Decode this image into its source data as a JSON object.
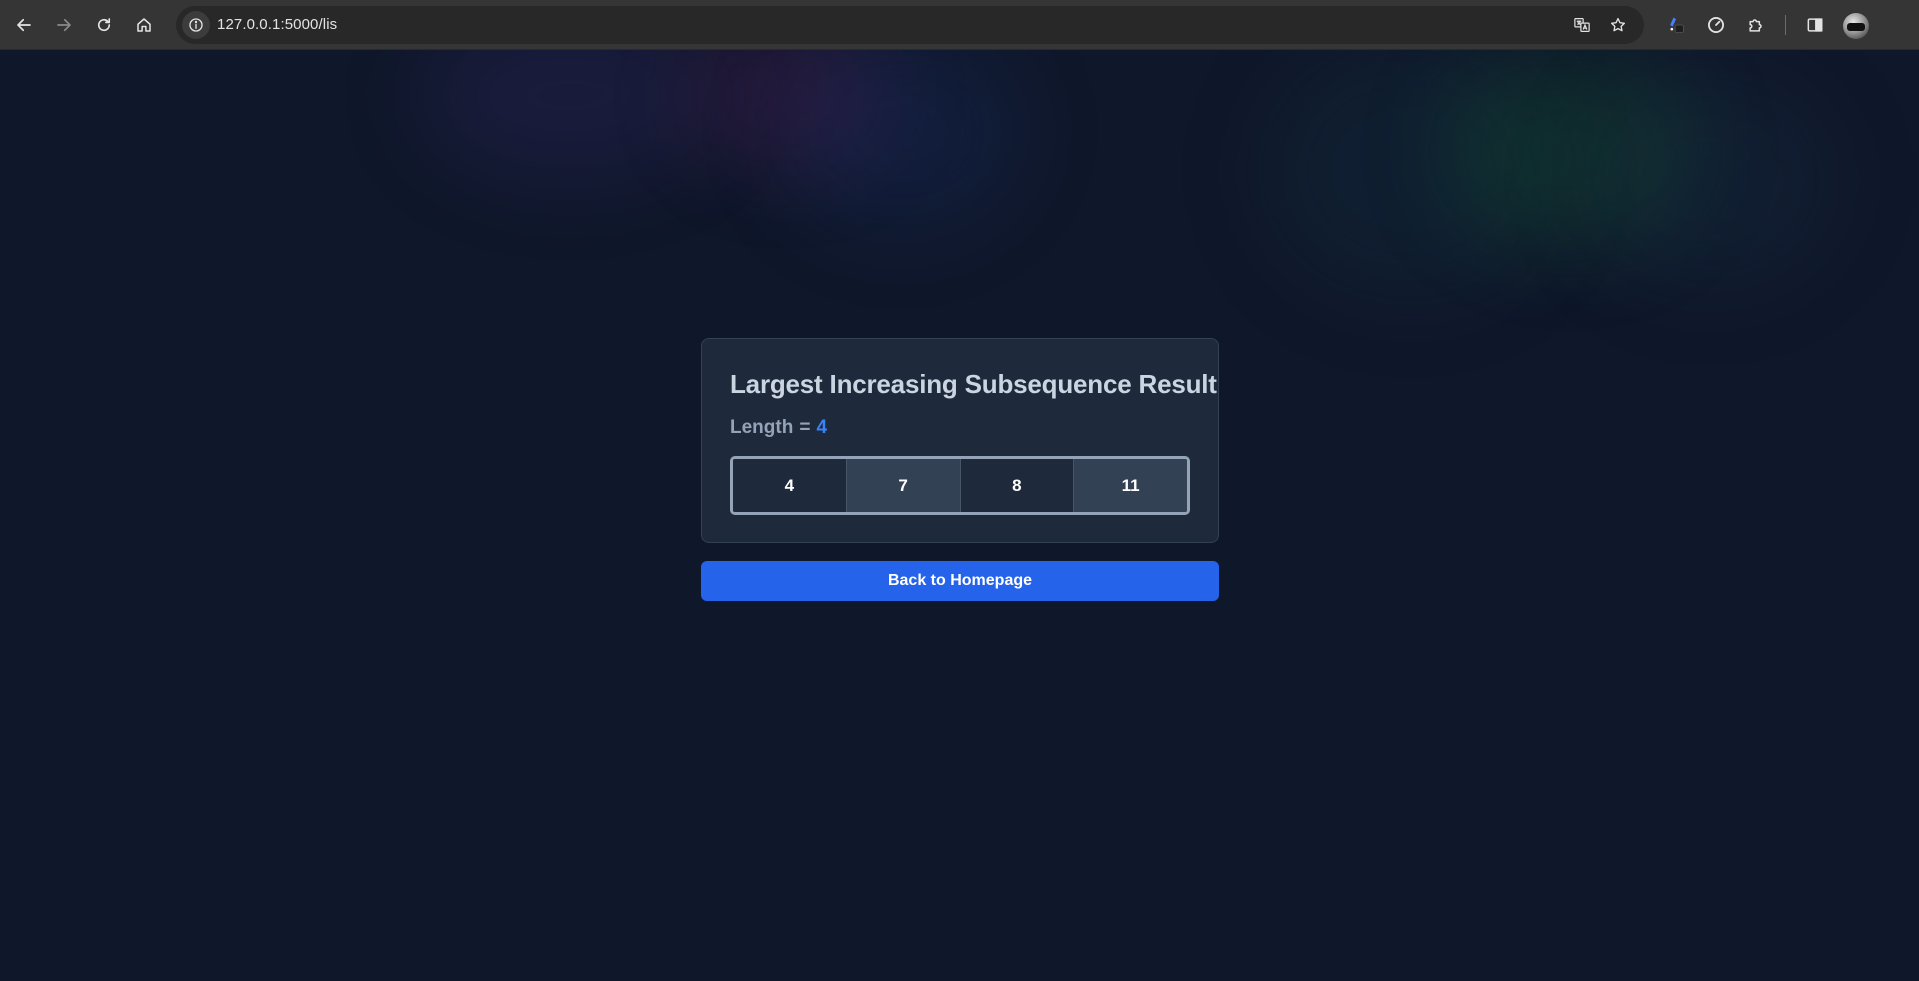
{
  "browser": {
    "url": "127.0.0.1:5000/lis",
    "icons": {
      "back": "arrow-left-icon",
      "forward": "arrow-right-icon",
      "reload": "reload-icon",
      "home": "home-icon",
      "site_info": "info-icon",
      "translate": "translate-icon",
      "bookmark": "star-icon",
      "extension_1": "pen-extension-icon",
      "extension_2": "gauge-extension-icon",
      "extensions": "puzzle-icon",
      "side_panel": "side-panel-icon",
      "profile": "avatar"
    }
  },
  "result": {
    "title": "Largest Increasing Subsequence Result",
    "length_label": "Length",
    "length_eq": "=",
    "length_value": "4",
    "sequence": [
      "4",
      "7",
      "8",
      "11"
    ]
  },
  "actions": {
    "back_label": "Back to Homepage"
  },
  "colors": {
    "page_bg": "#0f172a",
    "card_bg": "#1e293b",
    "accent": "#3b82f6",
    "button": "#2563eb"
  }
}
